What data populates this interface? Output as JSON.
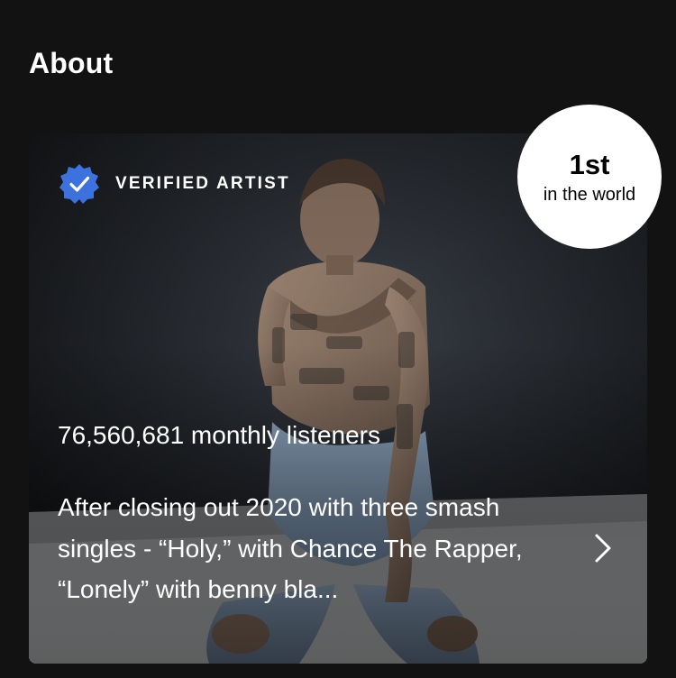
{
  "section": {
    "title": "About"
  },
  "card": {
    "image_icon": "artist-photo",
    "verified": {
      "icon": "verified-badge-icon",
      "label": "VERIFIED ARTIST",
      "badge_color": "#3d72de"
    },
    "monthly_listeners": "76,560,681 monthly listeners",
    "bio_snippet": "After closing out 2020 with three smash singles - “Holy,” with Chance The Rapper, “Lonely” with benny bla...",
    "more_icon": "chevron-right-icon"
  },
  "rank": {
    "position": "1st",
    "caption": "in the world"
  },
  "colors": {
    "background": "#121212",
    "text": "#ffffff",
    "rank_badge_bg": "#ffffff",
    "rank_badge_text": "#000000"
  }
}
